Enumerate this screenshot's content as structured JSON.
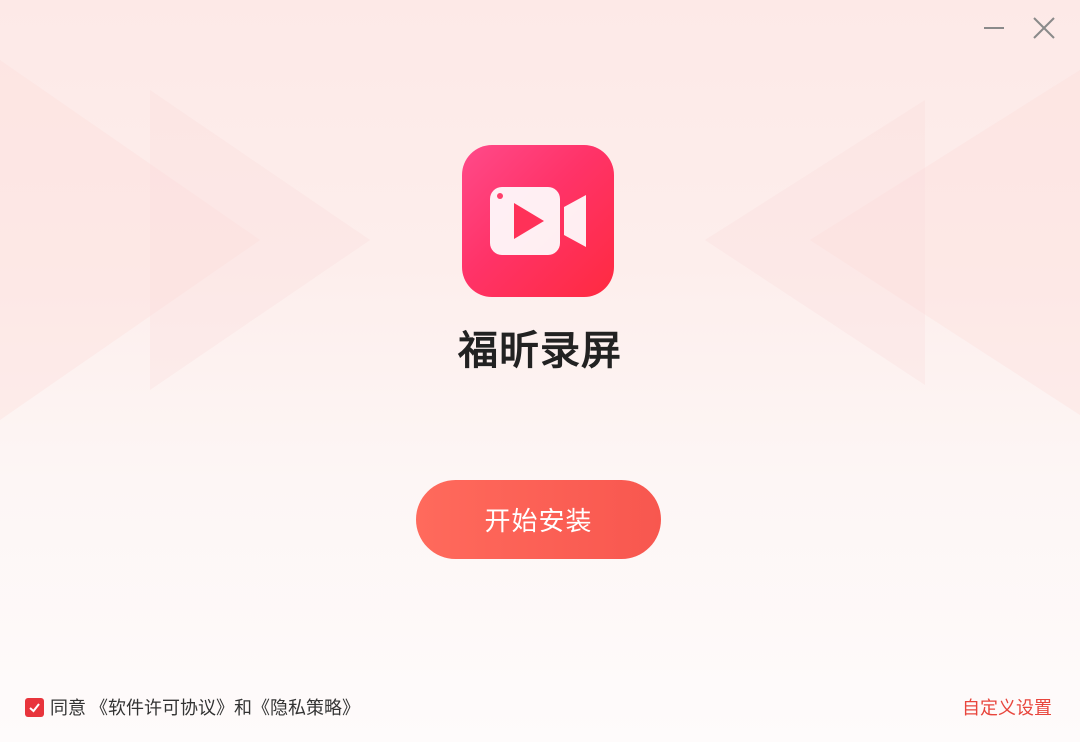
{
  "window": {
    "minimize_icon": "minimize-icon",
    "close_icon": "close-icon"
  },
  "app": {
    "icon": "video-camera-icon",
    "name": "福昕录屏"
  },
  "install_button": {
    "label": "开始安装"
  },
  "agreement": {
    "checked": true,
    "prefix": "同意",
    "license_link": "《软件许可协议》",
    "conjunction": "和",
    "privacy_link": "《隐私策略》"
  },
  "custom_settings": {
    "label": "自定义设置"
  },
  "colors": {
    "brand_gradient_start": "#ff4a8a",
    "brand_gradient_end": "#ff2a40",
    "button": "#f8574f",
    "link_accent": "#e8453c",
    "checkbox": "#e8343c"
  }
}
